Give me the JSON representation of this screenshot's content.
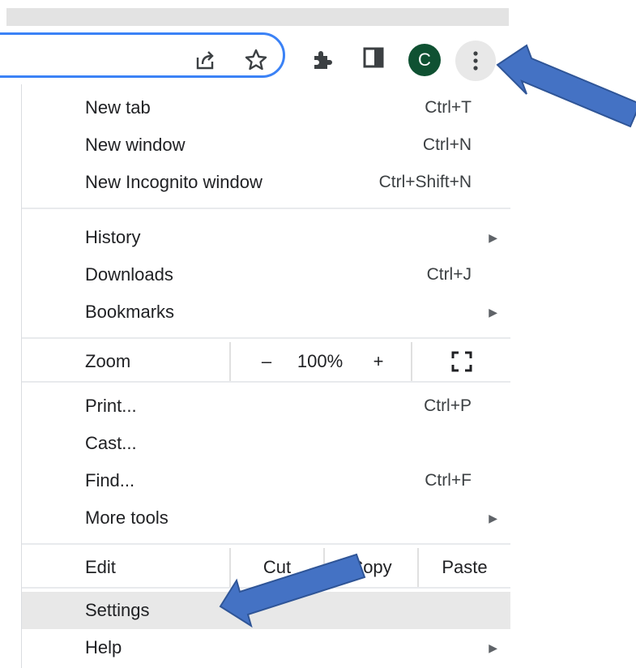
{
  "toolbar": {
    "share_icon": "share-icon",
    "star_icon": "star-icon",
    "extensions_icon": "puzzle-icon",
    "sidepanel_icon": "side-panel-icon",
    "avatar_letter": "C",
    "menu_icon": "three-dots-vertical-icon"
  },
  "menu": {
    "new_tab": {
      "label": "New tab",
      "shortcut": "Ctrl+T"
    },
    "new_window": {
      "label": "New window",
      "shortcut": "Ctrl+N"
    },
    "new_incognito": {
      "label": "New Incognito window",
      "shortcut": "Ctrl+Shift+N"
    },
    "history": {
      "label": "History"
    },
    "downloads": {
      "label": "Downloads",
      "shortcut": "Ctrl+J"
    },
    "bookmarks": {
      "label": "Bookmarks"
    },
    "zoom": {
      "label": "Zoom",
      "minus": "–",
      "value": "100%",
      "plus": "+"
    },
    "print": {
      "label": "Print...",
      "shortcut": "Ctrl+P"
    },
    "cast": {
      "label": "Cast..."
    },
    "find": {
      "label": "Find...",
      "shortcut": "Ctrl+F"
    },
    "more_tools": {
      "label": "More tools"
    },
    "edit": {
      "label": "Edit",
      "cut": "Cut",
      "copy": "Copy",
      "paste": "Paste"
    },
    "settings": {
      "label": "Settings"
    },
    "help": {
      "label": "Help"
    },
    "submenu_glyph": "▶"
  },
  "colors": {
    "accent": "#3b82f6",
    "annotation_arrow": "#4472c4",
    "avatar": "#0f5132",
    "highlight": "#e8e8e8"
  }
}
